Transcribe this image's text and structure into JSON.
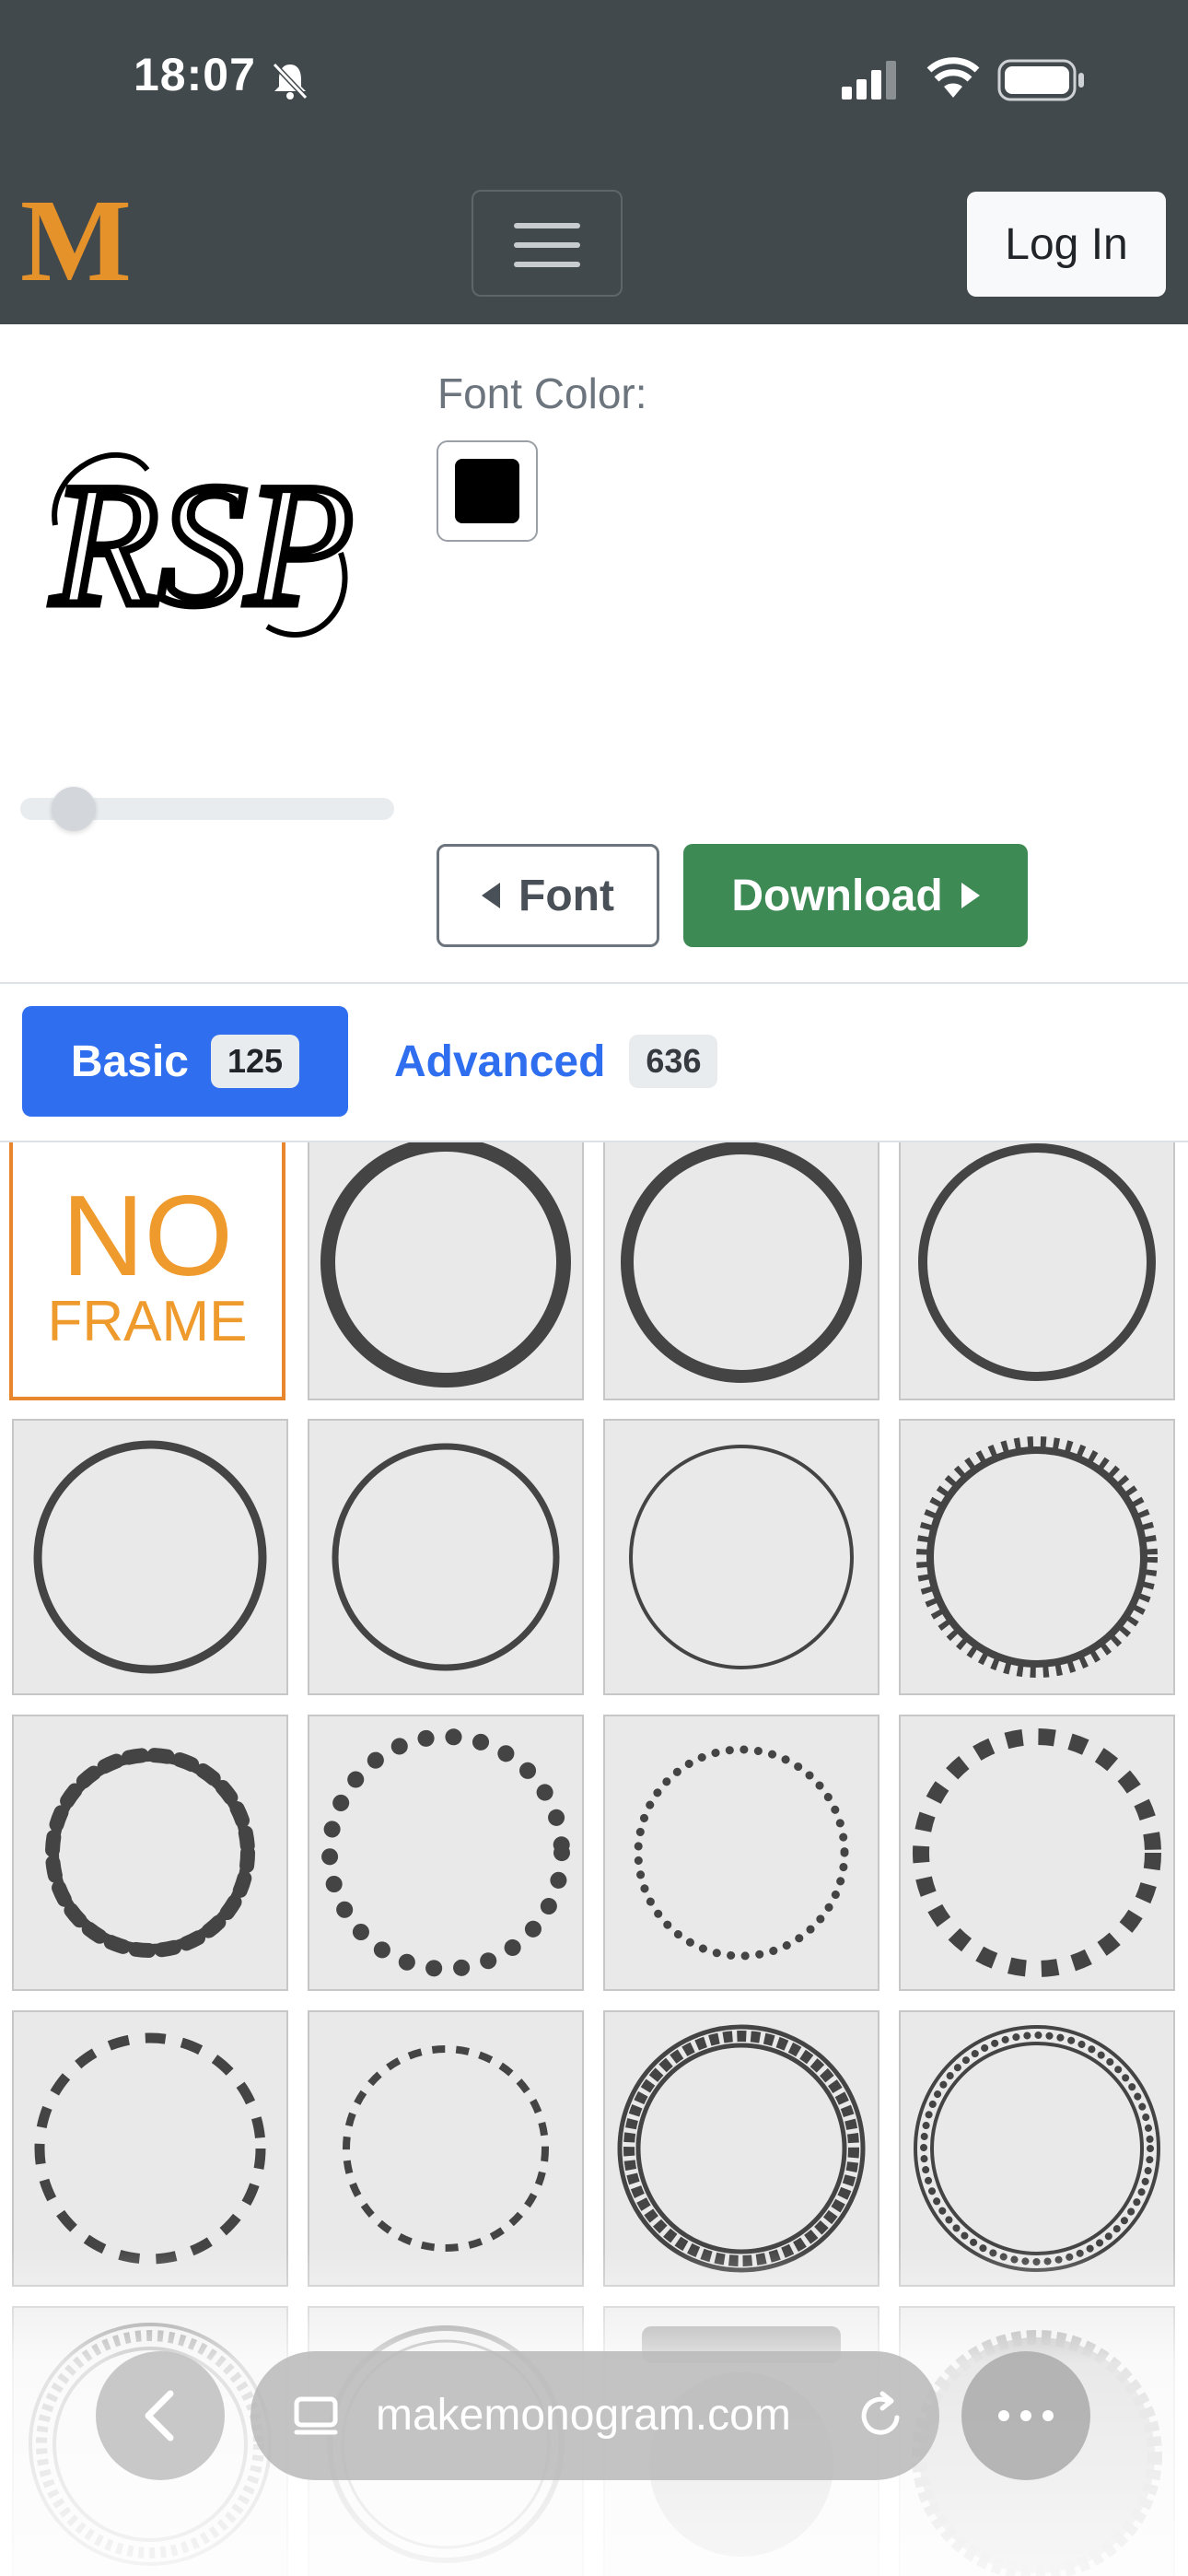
{
  "status_bar": {
    "time": "18:07"
  },
  "nav": {
    "logo": "M",
    "login_label": "Log In"
  },
  "editor": {
    "monogram_text": "RSP",
    "font_color_label": "Font Color:",
    "font_color": "#000000",
    "size_slider_value": 0.1,
    "font_button_label": "Font",
    "download_button_label": "Download"
  },
  "tabs": {
    "basic": {
      "label": "Basic",
      "count": "125"
    },
    "advanced": {
      "label": "Advanced",
      "count": "636"
    }
  },
  "frames": {
    "no_frame_line1": "NO",
    "no_frame_line2": "FRAME",
    "items": [
      "no-frame",
      "thick-ring",
      "thick-ring",
      "medium-ring",
      "medium-ring",
      "medium-ring",
      "thin-ring",
      "scalloped-ring",
      "scalloped-ring-small",
      "dot-ring-large",
      "dot-ring-small",
      "square-dash-ring",
      "dash-ring",
      "dash-ring-small",
      "double-square-ring",
      "double-dot-ring",
      "triangle-ring",
      "ornate-ring",
      "banner-ring",
      "scalloped-seal"
    ]
  },
  "browser": {
    "url": "makemonogram.com"
  },
  "colors": {
    "nav_bg": "#42494d",
    "brand": "#e6922a",
    "primary": "#2f6fef",
    "success": "#3d8a55",
    "frame_stroke": "#444444"
  }
}
